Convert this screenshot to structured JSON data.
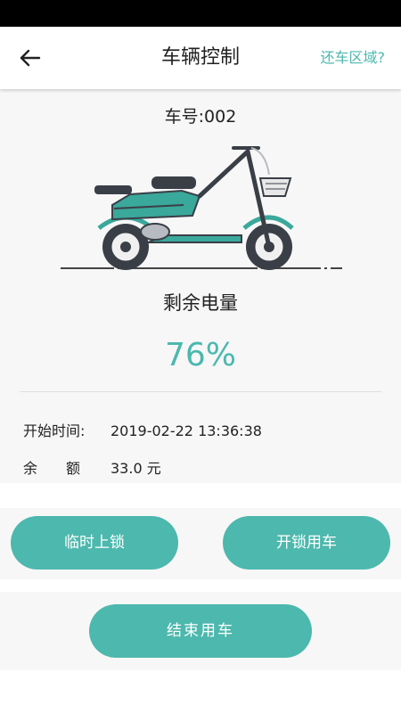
{
  "header": {
    "title": "车辆控制",
    "right_link": "还车区域?",
    "back_icon": "arrow-left-icon"
  },
  "vehicle": {
    "number_label": "车号:002",
    "image": "electric-scooter-illustration",
    "battery_label": "剩余电量",
    "battery_percent": "76%"
  },
  "info": {
    "start_time_label": "开始时间:",
    "start_time_value": "2019-02-22 13:36:38",
    "balance_label_1": "余",
    "balance_label_2": "额",
    "balance_value": "33.0 元"
  },
  "actions": {
    "temp_lock": "临时上锁",
    "unlock": "开锁用车",
    "end_ride": "结束用车"
  },
  "colors": {
    "accent": "#4bb8ad",
    "button": "#4db8ad",
    "panel_bg": "#f7f7f7"
  }
}
